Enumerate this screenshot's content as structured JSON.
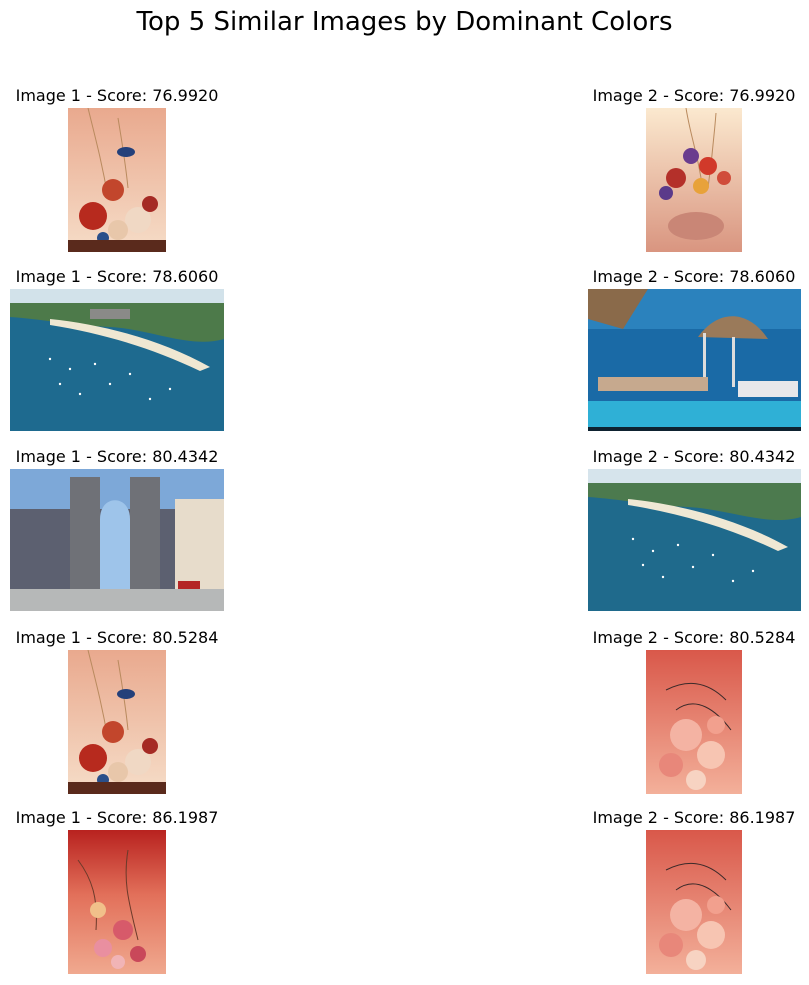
{
  "figure": {
    "title": "Top 5 Similar Images by Dominant Colors"
  },
  "rows": [
    {
      "left_caption": "Image 1 - Score: 76.9920",
      "right_caption": "Image 2 - Score: 76.9920"
    },
    {
      "left_caption": "Image 1 - Score: 78.6060",
      "right_caption": "Image 2 - Score: 78.6060"
    },
    {
      "left_caption": "Image 1 - Score: 80.4342",
      "right_caption": "Image 2 - Score: 80.4342"
    },
    {
      "left_caption": "Image 1 - Score: 80.5284",
      "right_caption": "Image 2 - Score: 80.5284"
    },
    {
      "left_caption": "Image 1 - Score: 86.1987",
      "right_caption": "Image 2 - Score: 86.1987"
    }
  ],
  "colors": {
    "peach": "#f1c3aa",
    "sea": "#1e6a8f",
    "stone": "#6f7177",
    "rose": "#e0816f",
    "crimson": "#c33d36"
  }
}
